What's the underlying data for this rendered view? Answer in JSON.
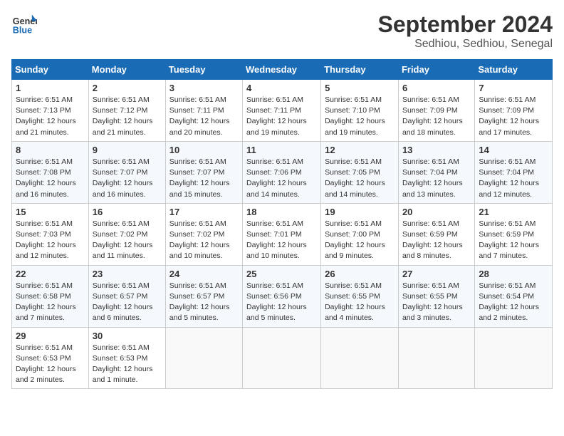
{
  "header": {
    "logo_general": "General",
    "logo_blue": "Blue",
    "month_year": "September 2024",
    "location": "Sedhiou, Sedhiou, Senegal"
  },
  "days_of_week": [
    "Sunday",
    "Monday",
    "Tuesday",
    "Wednesday",
    "Thursday",
    "Friday",
    "Saturday"
  ],
  "weeks": [
    [
      {
        "day": "1",
        "info": "Sunrise: 6:51 AM\nSunset: 7:13 PM\nDaylight: 12 hours\nand 21 minutes."
      },
      {
        "day": "2",
        "info": "Sunrise: 6:51 AM\nSunset: 7:12 PM\nDaylight: 12 hours\nand 21 minutes."
      },
      {
        "day": "3",
        "info": "Sunrise: 6:51 AM\nSunset: 7:11 PM\nDaylight: 12 hours\nand 20 minutes."
      },
      {
        "day": "4",
        "info": "Sunrise: 6:51 AM\nSunset: 7:11 PM\nDaylight: 12 hours\nand 19 minutes."
      },
      {
        "day": "5",
        "info": "Sunrise: 6:51 AM\nSunset: 7:10 PM\nDaylight: 12 hours\nand 19 minutes."
      },
      {
        "day": "6",
        "info": "Sunrise: 6:51 AM\nSunset: 7:09 PM\nDaylight: 12 hours\nand 18 minutes."
      },
      {
        "day": "7",
        "info": "Sunrise: 6:51 AM\nSunset: 7:09 PM\nDaylight: 12 hours\nand 17 minutes."
      }
    ],
    [
      {
        "day": "8",
        "info": "Sunrise: 6:51 AM\nSunset: 7:08 PM\nDaylight: 12 hours\nand 16 minutes."
      },
      {
        "day": "9",
        "info": "Sunrise: 6:51 AM\nSunset: 7:07 PM\nDaylight: 12 hours\nand 16 minutes."
      },
      {
        "day": "10",
        "info": "Sunrise: 6:51 AM\nSunset: 7:07 PM\nDaylight: 12 hours\nand 15 minutes."
      },
      {
        "day": "11",
        "info": "Sunrise: 6:51 AM\nSunset: 7:06 PM\nDaylight: 12 hours\nand 14 minutes."
      },
      {
        "day": "12",
        "info": "Sunrise: 6:51 AM\nSunset: 7:05 PM\nDaylight: 12 hours\nand 14 minutes."
      },
      {
        "day": "13",
        "info": "Sunrise: 6:51 AM\nSunset: 7:04 PM\nDaylight: 12 hours\nand 13 minutes."
      },
      {
        "day": "14",
        "info": "Sunrise: 6:51 AM\nSunset: 7:04 PM\nDaylight: 12 hours\nand 12 minutes."
      }
    ],
    [
      {
        "day": "15",
        "info": "Sunrise: 6:51 AM\nSunset: 7:03 PM\nDaylight: 12 hours\nand 12 minutes."
      },
      {
        "day": "16",
        "info": "Sunrise: 6:51 AM\nSunset: 7:02 PM\nDaylight: 12 hours\nand 11 minutes."
      },
      {
        "day": "17",
        "info": "Sunrise: 6:51 AM\nSunset: 7:02 PM\nDaylight: 12 hours\nand 10 minutes."
      },
      {
        "day": "18",
        "info": "Sunrise: 6:51 AM\nSunset: 7:01 PM\nDaylight: 12 hours\nand 10 minutes."
      },
      {
        "day": "19",
        "info": "Sunrise: 6:51 AM\nSunset: 7:00 PM\nDaylight: 12 hours\nand 9 minutes."
      },
      {
        "day": "20",
        "info": "Sunrise: 6:51 AM\nSunset: 6:59 PM\nDaylight: 12 hours\nand 8 minutes."
      },
      {
        "day": "21",
        "info": "Sunrise: 6:51 AM\nSunset: 6:59 PM\nDaylight: 12 hours\nand 7 minutes."
      }
    ],
    [
      {
        "day": "22",
        "info": "Sunrise: 6:51 AM\nSunset: 6:58 PM\nDaylight: 12 hours\nand 7 minutes."
      },
      {
        "day": "23",
        "info": "Sunrise: 6:51 AM\nSunset: 6:57 PM\nDaylight: 12 hours\nand 6 minutes."
      },
      {
        "day": "24",
        "info": "Sunrise: 6:51 AM\nSunset: 6:57 PM\nDaylight: 12 hours\nand 5 minutes."
      },
      {
        "day": "25",
        "info": "Sunrise: 6:51 AM\nSunset: 6:56 PM\nDaylight: 12 hours\nand 5 minutes."
      },
      {
        "day": "26",
        "info": "Sunrise: 6:51 AM\nSunset: 6:55 PM\nDaylight: 12 hours\nand 4 minutes."
      },
      {
        "day": "27",
        "info": "Sunrise: 6:51 AM\nSunset: 6:55 PM\nDaylight: 12 hours\nand 3 minutes."
      },
      {
        "day": "28",
        "info": "Sunrise: 6:51 AM\nSunset: 6:54 PM\nDaylight: 12 hours\nand 2 minutes."
      }
    ],
    [
      {
        "day": "29",
        "info": "Sunrise: 6:51 AM\nSunset: 6:53 PM\nDaylight: 12 hours\nand 2 minutes."
      },
      {
        "day": "30",
        "info": "Sunrise: 6:51 AM\nSunset: 6:53 PM\nDaylight: 12 hours\nand 1 minute."
      },
      null,
      null,
      null,
      null,
      null
    ]
  ]
}
